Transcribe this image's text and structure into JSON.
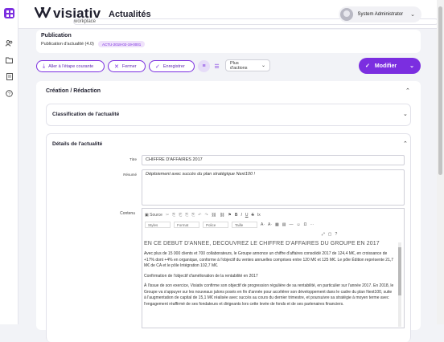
{
  "brand": {
    "name": "visiativ",
    "tagline": "workplace",
    "color": "#7b2ee0"
  },
  "page": {
    "title": "Actualités"
  },
  "user": {
    "name": "System Administrator"
  },
  "rail": {
    "icons": [
      "apps-grid-icon",
      "users-icon",
      "folder-icon",
      "document-icon",
      "help-icon"
    ]
  },
  "publication": {
    "type": "Publication",
    "label": "Publication d'actualité (4.0)",
    "reference": "ACTU-2018-02-19-0001"
  },
  "toolbar": {
    "next_step": "Aller à l'étape courante",
    "close": "Fermer",
    "save": "Enregistrer",
    "more_actions": "Plus d'actions",
    "modify": "Modifier"
  },
  "section": {
    "title": "Création / Rédaction"
  },
  "classification": {
    "title": "Classification de l'actualité"
  },
  "details": {
    "title": "Détails de l'actualité",
    "title_label": "Titre",
    "title_value": "CHIFFRE D'AFFAIRES 2017",
    "summary_label": "Résumé",
    "summary_value": "Déploiement avec succès du plan stratégique Next100 !",
    "content_label": "Contenu"
  },
  "editor": {
    "toolbar_row1": [
      "Source"
    ],
    "styles": "Styles",
    "format": "Format",
    "font": "Police",
    "size": "Taille",
    "heading": "EN CE DÉBUT D'ANNÉE, DÉCOUVREZ LE CHIFFRE D'AFFAIRES DU GROUPE EN 2017",
    "paragraphs": [
      "Avec plus de 15 000 clients et 700 collaborateurs, le Groupe annonce un chiffre d'affaires consolidé 2017 de 124,4 M€, en croissance de +17% dont +4% en organique, conforme à l'objectif du ventes annuelles comprises entre 120 M€ et 125 M€. Le pôle Édition représente 21,7 M€ de CA et le pôle Intégration 102,7 M€.",
      "Confirmation de l'objectif d'amélioration de la rentabilité en 2017",
      "À l'issue de son exercice, Visiativ confirme son objectif de progression régulière de sa rentabilité, en particulier sur l'année 2017. En 2018, le Groupe va s'appuyer sur les nouveaux jalons posés en fin d'année pour accélérer son développement dans le cadre du plan Next100, suite à l'augmentation de capital de 15,1 M€ réalisée avec succès au cours du dernier trimestre, et poursuivre sa stratégie à moyen terme avec l'engagement réaffirmé de ses fondateurs et dirigeants lors cette levée de fonds et de ses partenaires financiers."
    ]
  }
}
